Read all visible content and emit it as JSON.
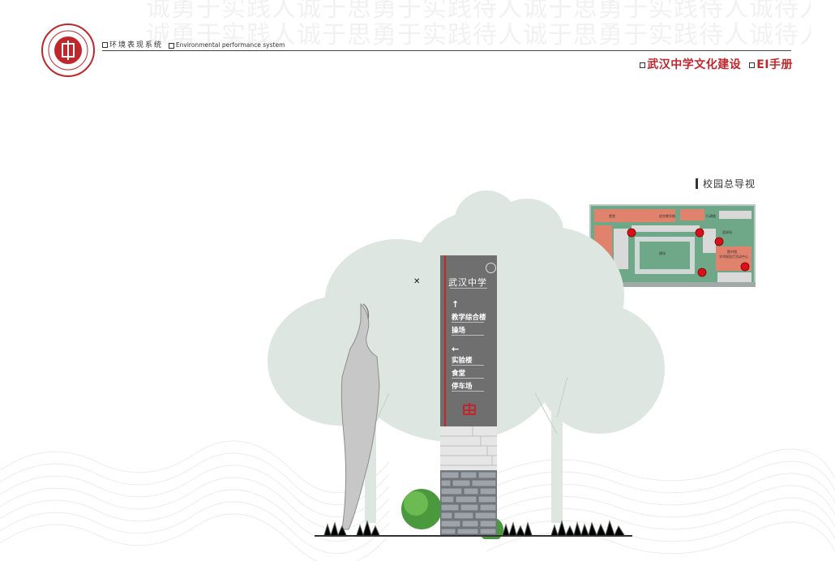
{
  "header": {
    "system_cn": "环境表现系统",
    "system_en": "Environmental performance system",
    "manual_title_left": "武汉中学文化建设",
    "manual_title_right": "EI手册"
  },
  "background_text": "诚勇于实践人诚于思勇于实践待人诚于思勇于实践待人诚待人诚于思勇于实践待人勇于实践",
  "section": {
    "label": "校园总导视"
  },
  "sign": {
    "school_name": "武汉中学",
    "group1": {
      "arrow": "↑",
      "items": [
        "教学综合楼",
        "操场"
      ]
    },
    "group2": {
      "arrow": "←",
      "items": [
        "实验楼",
        "食堂",
        "停车场"
      ]
    }
  },
  "campus_map": {
    "labels": [
      "食堂",
      "综合教学楼",
      "行政楼",
      "实验楼",
      "篮球场",
      "操场",
      "图书馆",
      "学术报告厅活动中心"
    ],
    "marker_color": "#d7101a"
  },
  "colors": {
    "brand_red": "#c0272d",
    "pylon_gray": "#6f6f6f",
    "tree_green": "#dde6e1",
    "map_green": "#6fa889",
    "map_building": "#e0826c"
  }
}
